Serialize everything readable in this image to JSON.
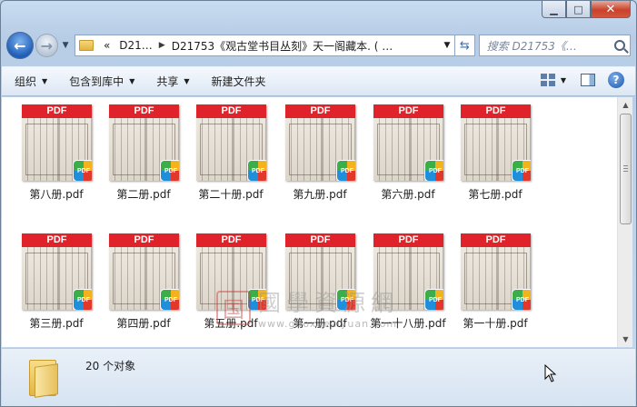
{
  "window": {
    "minimize_glyph": "▁",
    "maximize_glyph": "□",
    "close_glyph": "✕"
  },
  "address": {
    "breadcrumbs": [
      "«",
      "D21…",
      "D21753《观古堂书目丛刻》天一阁藏本. ( …"
    ],
    "search_placeholder": "搜索 D21753《…"
  },
  "toolbar": {
    "organize": "组织",
    "include_library": "包含到库中",
    "share": "共享",
    "new_folder": "新建文件夹"
  },
  "files": [
    {
      "name": "第八册.pdf"
    },
    {
      "name": "第二册.pdf"
    },
    {
      "name": "第二十册.pdf"
    },
    {
      "name": "第九册.pdf"
    },
    {
      "name": "第六册.pdf"
    },
    {
      "name": "第七册.pdf"
    },
    {
      "name": "第三册.pdf"
    },
    {
      "name": "第四册.pdf"
    },
    {
      "name": "第五册.pdf"
    },
    {
      "name": "第一册.pdf"
    },
    {
      "name": "第一十八册.pdf"
    },
    {
      "name": "第一十册.pdf"
    }
  ],
  "thumb_band_label": "PDF",
  "badge_label": "PDF",
  "watermark": {
    "seal": "国",
    "title": "國學資源網",
    "url": "www.guoxueziyuan.com"
  },
  "status": {
    "count": "20 个对象"
  }
}
